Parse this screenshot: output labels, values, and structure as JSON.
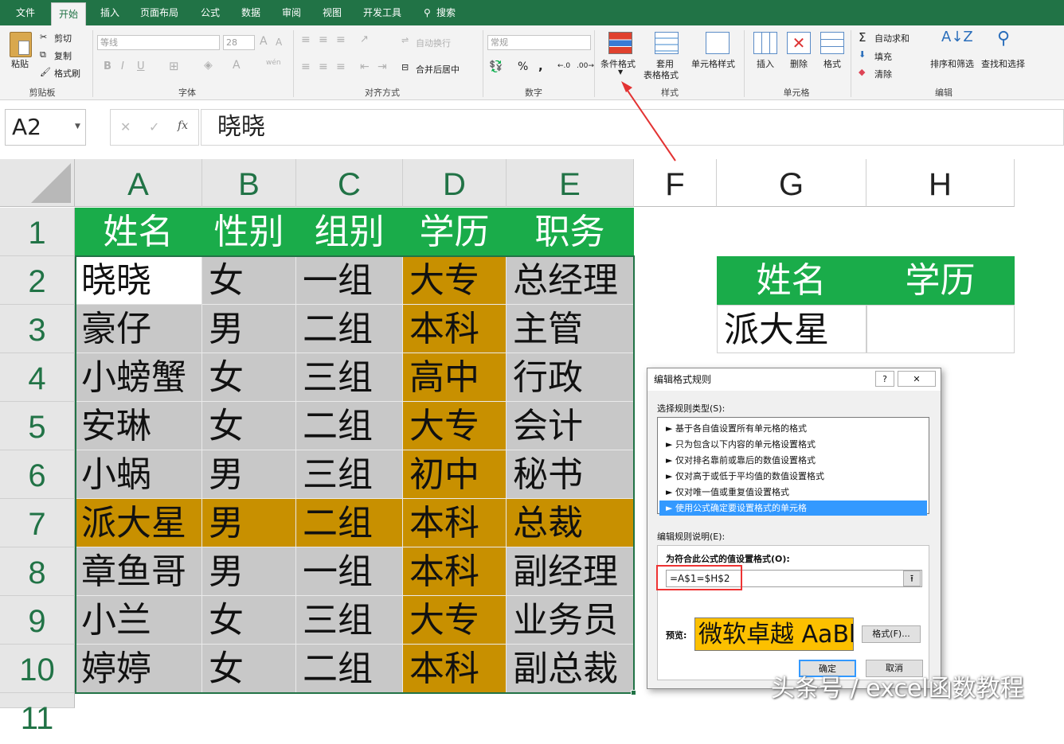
{
  "menu": {
    "tabs": [
      "文件",
      "开始",
      "插入",
      "页面布局",
      "公式",
      "数据",
      "审阅",
      "视图",
      "开发工具",
      "搜索"
    ]
  },
  "ribbon": {
    "clipboard": {
      "paste": "粘贴",
      "cut": "剪切",
      "copy": "复制",
      "format_painter": "格式刷",
      "group": "剪贴板"
    },
    "font": {
      "name": "等线",
      "size": "28",
      "group": "字体",
      "wen": "wén"
    },
    "align": {
      "wrap": "自动换行",
      "merge": "合并后居中",
      "group": "对齐方式"
    },
    "number": {
      "format": "常规",
      "percent": "%",
      "comma": ",",
      "group": "数字"
    },
    "styles": {
      "cond_format": "条件格式",
      "table_fmt_1": "套用",
      "table_fmt_2": "表格格式",
      "cell_style": "单元格样式",
      "group": "样式"
    },
    "cells": {
      "insert": "插入",
      "delete": "删除",
      "format": "格式",
      "group": "单元格"
    },
    "editing": {
      "autosum": "自动求和",
      "fill": "填充",
      "clear": "清除",
      "sort": "排序和筛选",
      "find": "查找和选择",
      "group": "编辑"
    }
  },
  "formula_bar": {
    "name_box": "A2",
    "formula": "晓晓",
    "fx": "fx"
  },
  "sheet": {
    "columns": [
      "A",
      "B",
      "C",
      "D",
      "E",
      "F",
      "G",
      "H"
    ],
    "rows": [
      "1",
      "2",
      "3",
      "4",
      "5",
      "6",
      "7",
      "8",
      "9",
      "10",
      "11"
    ],
    "data": [
      [
        "姓名",
        "性别",
        "组别",
        "学历",
        "职务"
      ],
      [
        "晓晓",
        "女",
        "一组",
        "大专",
        "总经理"
      ],
      [
        "豪仔",
        "男",
        "二组",
        "本科",
        "主管"
      ],
      [
        "小螃蟹",
        "女",
        "三组",
        "高中",
        "行政"
      ],
      [
        "安琳",
        "女",
        "二组",
        "大专",
        "会计"
      ],
      [
        "小蜗",
        "男",
        "三组",
        "初中",
        "秘书"
      ],
      [
        "派大星",
        "男",
        "二组",
        "本科",
        "总裁"
      ],
      [
        "章鱼哥",
        "男",
        "一组",
        "本科",
        "副经理"
      ],
      [
        "小兰",
        "女",
        "三组",
        "大专",
        "业务员"
      ],
      [
        "婷婷",
        "女",
        "二组",
        "本科",
        "副总裁"
      ]
    ],
    "lookup": {
      "h1": "姓名",
      "h2": "学历",
      "value": "派大星",
      "result": ""
    }
  },
  "dialog": {
    "title": "编辑格式规则",
    "help": "?",
    "close": "✕",
    "select_type_label": "选择规则类型(S):",
    "rule_types": [
      "► 基于各自值设置所有单元格的格式",
      "► 只为包含以下内容的单元格设置格式",
      "► 仅对排名靠前或靠后的数值设置格式",
      "► 仅对高于或低于平均值的数值设置格式",
      "► 仅对唯一值或重复值设置格式",
      "► 使用公式确定要设置格式的单元格"
    ],
    "edit_desc_label": "编辑规则说明(E):",
    "formula_label": "为符合此公式的值设置格式(O):",
    "formula": "=A$1=$H$2",
    "preview_label": "预览:",
    "preview_text": "微软卓越  AaBbCc",
    "format_btn": "格式(F)...",
    "ok": "确定",
    "cancel": "取消"
  },
  "watermark": "头条号 / excel函数教程",
  "colors": {
    "excel_green": "#217346",
    "header_fill": "#1aac4a",
    "highlight": "#c89000",
    "gray_fill": "#c8c8c8",
    "preview": "#fcc000",
    "annotation": "#e33333"
  }
}
